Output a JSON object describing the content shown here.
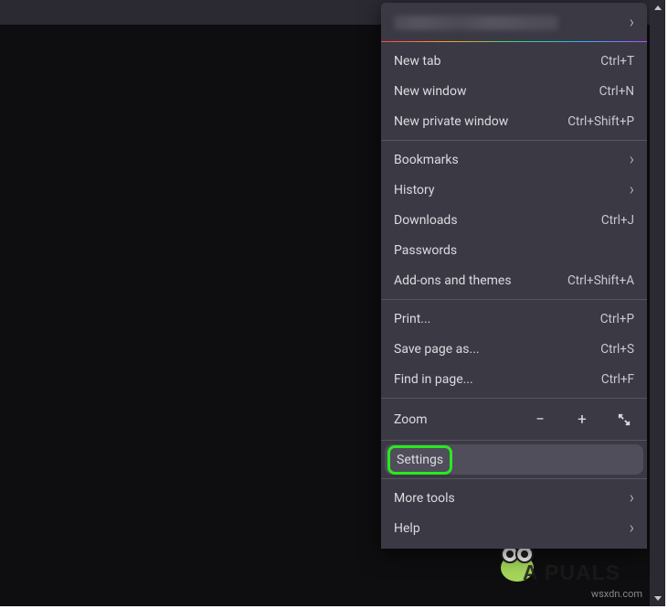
{
  "account": {
    "label": "blurred-email"
  },
  "group_tabs": [
    {
      "label": "New tab",
      "shortcut": "Ctrl+T"
    },
    {
      "label": "New window",
      "shortcut": "Ctrl+N"
    },
    {
      "label": "New private window",
      "shortcut": "Ctrl+Shift+P"
    }
  ],
  "group_library": [
    {
      "label": "Bookmarks",
      "submenu": true
    },
    {
      "label": "History",
      "submenu": true
    },
    {
      "label": "Downloads",
      "shortcut": "Ctrl+J"
    },
    {
      "label": "Passwords"
    },
    {
      "label": "Add-ons and themes",
      "shortcut": "Ctrl+Shift+A"
    }
  ],
  "group_page": [
    {
      "label": "Print...",
      "shortcut": "Ctrl+P"
    },
    {
      "label": "Save page as...",
      "shortcut": "Ctrl+S"
    },
    {
      "label": "Find in page...",
      "shortcut": "Ctrl+F"
    }
  ],
  "zoom": {
    "label": "Zoom",
    "minus": "−",
    "plus": "+"
  },
  "group_settings": [
    {
      "label": "Settings",
      "highlight": true
    }
  ],
  "group_more": [
    {
      "label": "More tools",
      "submenu": true
    },
    {
      "label": "Help",
      "submenu": true
    }
  ],
  "watermark": "wsxdn.com",
  "brand": "A  PUALS"
}
